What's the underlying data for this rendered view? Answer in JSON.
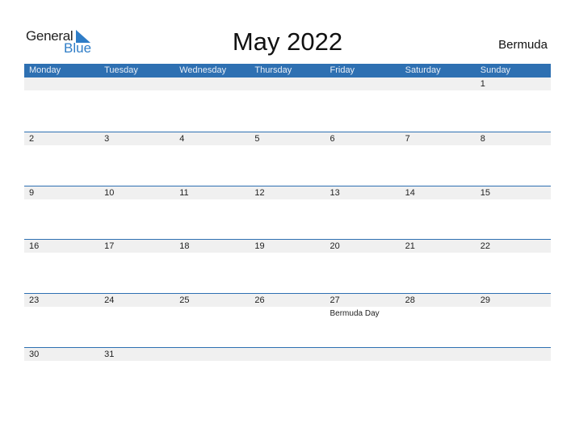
{
  "logo": {
    "general": "General",
    "blue": "Blue"
  },
  "title": "May 2022",
  "country": "Bermuda",
  "colors": {
    "accent": "#2e70b2",
    "row_bg": "#f0f0f0"
  },
  "weekdays": [
    "Monday",
    "Tuesday",
    "Wednesday",
    "Thursday",
    "Friday",
    "Saturday",
    "Sunday"
  ],
  "weeks": [
    [
      "",
      "",
      "",
      "",
      "",
      "",
      "1"
    ],
    [
      "2",
      "3",
      "4",
      "5",
      "6",
      "7",
      "8"
    ],
    [
      "9",
      "10",
      "11",
      "12",
      "13",
      "14",
      "15"
    ],
    [
      "16",
      "17",
      "18",
      "19",
      "20",
      "21",
      "22"
    ],
    [
      "23",
      "24",
      "25",
      "26",
      "27",
      "28",
      "29"
    ],
    [
      "30",
      "31",
      "",
      "",
      "",
      "",
      ""
    ]
  ],
  "events": {
    "27": "Bermuda Day"
  }
}
